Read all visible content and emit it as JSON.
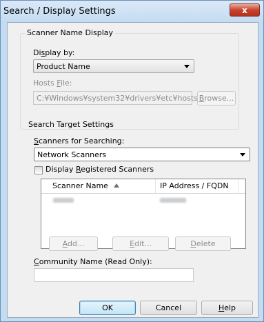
{
  "window": {
    "title": "Search / Display Settings",
    "close_label": "x"
  },
  "scanner_name_display": {
    "legend": "Scanner Name Display",
    "display_by_label_pre": "Di",
    "display_by_label_key": "s",
    "display_by_label_post": "play by:",
    "display_by_value": "Product Name",
    "hosts_file_label_pre": "Hosts ",
    "hosts_file_label_key": "F",
    "hosts_file_label_post": "ile:",
    "hosts_file_value": "C:¥Windows¥system32¥drivers¥etc¥hosts",
    "browse_label_key": "B",
    "browse_label_post": "rowse..."
  },
  "search_target": {
    "legend": "Search Target Settings",
    "scanners_label_key": "S",
    "scanners_label_post": "canners for Searching:",
    "scanners_value": "Network Scanners",
    "display_registered_pre": "Display ",
    "display_registered_key": "R",
    "display_registered_post": "egistered Scanners",
    "display_registered_checked": false,
    "columns": [
      "Scanner Name",
      "IP Address / FQDN"
    ],
    "sort_icon": "sort-ascending-icon",
    "rows": [
      {
        "name": "",
        "ip": ""
      }
    ],
    "add_key": "A",
    "add_post": "dd...",
    "edit_key": "E",
    "edit_post": "dit...",
    "delete_key": "D",
    "delete_post": "elete",
    "community_key": "C",
    "community_post": "ommunity Name (Read Only):",
    "community_value": ""
  },
  "footer": {
    "ok_label": "OK",
    "cancel_label": "Cancel",
    "help_key": "H",
    "help_post": "elp"
  }
}
